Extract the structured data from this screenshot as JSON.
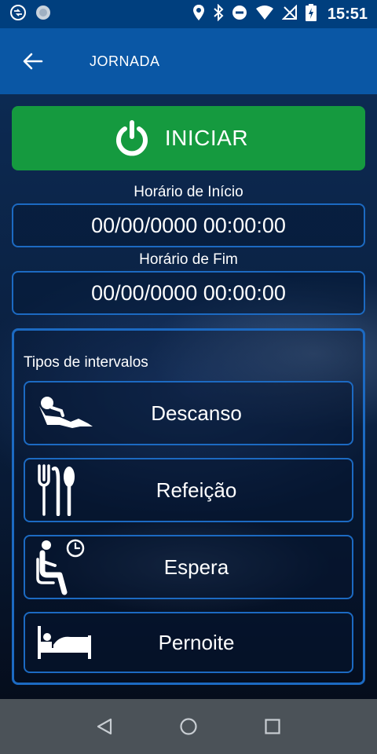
{
  "status_bar": {
    "time": "15:51",
    "icons": [
      "cast-icon",
      "sync-icon",
      "location-icon",
      "bluetooth-icon",
      "dnd-icon",
      "wifi-icon",
      "no-signal-icon",
      "battery-charging-icon"
    ]
  },
  "app_bar": {
    "title": "JORNADA",
    "back_icon": "arrow-left-icon"
  },
  "start_button": {
    "label": "INICIAR",
    "icon": "power-icon",
    "color": "#159a3f"
  },
  "start_time": {
    "label": "Horário de Início",
    "value": "00/00/0000 00:00:00"
  },
  "end_time": {
    "label": "Horário de Fim",
    "value": "00/00/0000 00:00:00"
  },
  "intervals": {
    "title": "Tipos de intervalos",
    "items": [
      {
        "label": "Descanso",
        "icon": "resting-person-icon"
      },
      {
        "label": "Refeição",
        "icon": "cutlery-icon"
      },
      {
        "label": "Espera",
        "icon": "waiting-person-clock-icon"
      },
      {
        "label": "Pernoite",
        "icon": "bed-person-icon"
      }
    ]
  },
  "nav_bar": {
    "buttons": [
      "back-triangle-icon",
      "home-circle-icon",
      "recents-square-icon"
    ]
  },
  "colors": {
    "status_bar": "#003f7e",
    "app_bar": "#0a57a5",
    "border_accent": "#1c6ac2",
    "nav_bar": "#4b5258"
  }
}
